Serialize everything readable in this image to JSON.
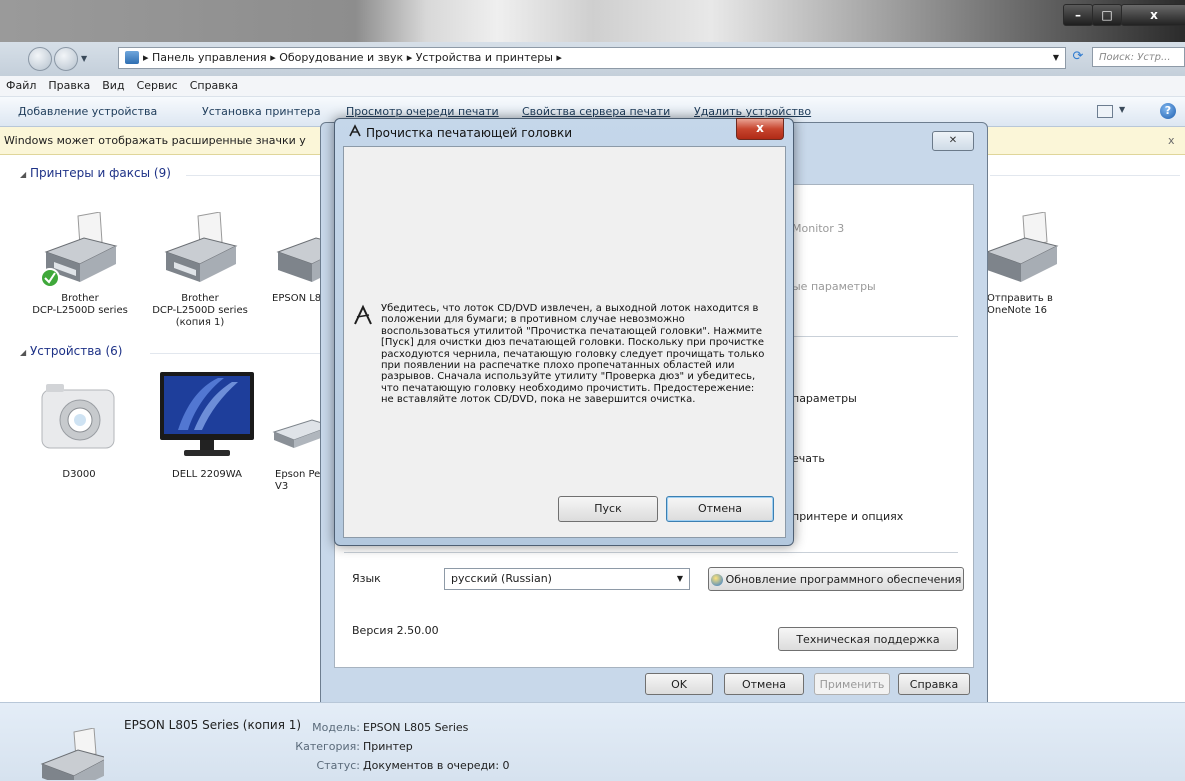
{
  "window": {
    "buttons": {
      "minimize": "–",
      "maximize": "□",
      "close": "x"
    }
  },
  "address": {
    "crumbs": [
      "Панель управления",
      "Оборудование и звук",
      "Устройства и принтеры"
    ],
    "search_placeholder": "Поиск: Устр... "
  },
  "menu": [
    "Файл",
    "Правка",
    "Вид",
    "Сервис",
    "Справка"
  ],
  "commands": [
    "Добавление устройства",
    "Установка принтера",
    "Просмотр очереди печати",
    "Свойства сервера печати",
    "Удалить устройство"
  ],
  "infobar": {
    "text": "Windows может отображать расширенные значки у",
    "close": "x"
  },
  "groups": {
    "printers": {
      "title": "Принтеры и факсы (9)"
    },
    "devices": {
      "title": "Устройства (6)"
    }
  },
  "printers": [
    {
      "label": "Brother\nDCP-L2500D series"
    },
    {
      "label": "Brother\nDCP-L2500D series\n(копия 1)"
    },
    {
      "label": "EPSON L8"
    },
    {
      "label": "Отправить в\nOneNote 16"
    }
  ],
  "devices": [
    {
      "label": "D3000"
    },
    {
      "label": "DELL 2209WA"
    },
    {
      "label": "Epson Pe\nV3"
    }
  ],
  "properties_dialog": {
    "close": "✕",
    "partial_texts": [
      "Monitor 3",
      "ые параметры",
      "параметры",
      "ечать",
      "принтере и опциях"
    ],
    "language_label": "Язык",
    "language_value": "русский (Russian)",
    "update_button": "Обновление программного обеспечения",
    "version": "Версия 2.50.00",
    "support_button": "Техническая поддержка",
    "ok": "OK",
    "cancel": "Отмена",
    "apply": "Применить",
    "help": "Справка"
  },
  "cleaning_dialog": {
    "title": "Прочистка печатающей головки",
    "message": "Убедитесь, что лоток CD/DVD извлечен, а выходной лоток находится в положении для бумаги; в противном случае невозможно воспользоваться утилитой \"Прочистка печатающей головки\". Нажмите [Пуск] для очистки дюз печатающей головки. Поскольку при прочистке расходуются чернила, печатающую головку следует прочищать только при появлении на распечатке плохо пропечатанных областей или разрывов. Сначала используйте утилиту \"Проверка дюз\" и убедитесь, что печатающую головку необходимо прочистить. Предостережение: не вставляйте лоток CD/DVD, пока не завершится очистка.",
    "start_button": "Пуск",
    "cancel_button": "Отмена",
    "close": "x"
  },
  "details": {
    "name": "EPSON L805 Series (копия 1)",
    "model_label": "Модель:",
    "model_value": "EPSON L805 Series",
    "category_label": "Категория:",
    "category_value": "Принтер",
    "status_label": "Статус:",
    "status_value": "Документов в очереди: 0"
  }
}
